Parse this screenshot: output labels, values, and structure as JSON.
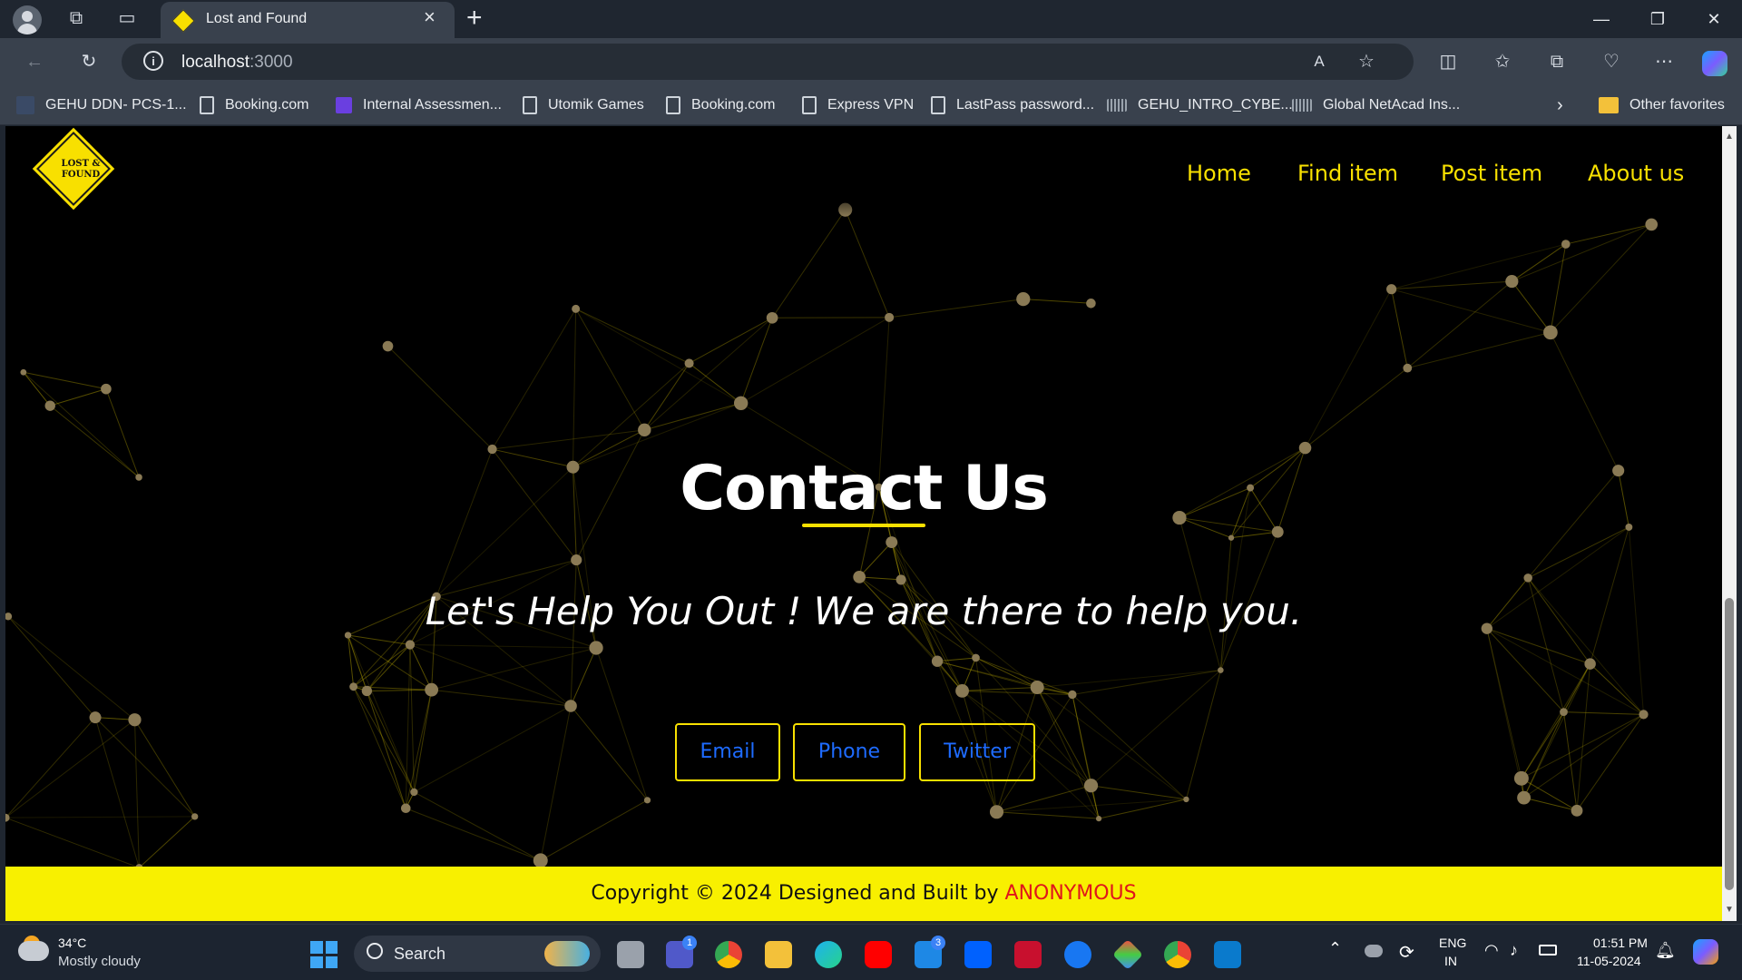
{
  "browser": {
    "tab": {
      "title": "Lost and Found"
    },
    "url": {
      "host": "localhost",
      "port": ":3000"
    },
    "favorites": [
      {
        "label": "GEHU DDN- PCS-1..."
      },
      {
        "label": "Booking.com"
      },
      {
        "label": "Internal Assessmen..."
      },
      {
        "label": "Utomik Games"
      },
      {
        "label": "Booking.com"
      },
      {
        "label": "Express VPN"
      },
      {
        "label": "LastPass password..."
      },
      {
        "label": "GEHU_INTRO_CYBE..."
      },
      {
        "label": "Global NetAcad Ins..."
      }
    ],
    "other_favorites": "Other favorites"
  },
  "site": {
    "logo_text": "LOST & FOUND",
    "nav": [
      "Home",
      "Find item",
      "Post item",
      "About us"
    ],
    "heading": "Contact Us",
    "tagline": "Let's Help You Out ! We are there to help you.",
    "buttons": [
      "Email",
      "Phone",
      "Twitter"
    ],
    "footer": {
      "text": "Copyright © 2024 Designed and Built by",
      "author": "ANONYMOUS"
    },
    "colors": {
      "accent": "#f8e000",
      "button_text": "#1e6bff",
      "author": "#e0161b"
    }
  },
  "taskbar": {
    "weather": {
      "temp": "34°C",
      "desc": "Mostly cloudy"
    },
    "search": "Search",
    "badges": {
      "teams": "1",
      "mail": "3"
    },
    "language": {
      "line1": "ENG",
      "line2": "IN"
    },
    "clock": {
      "time": "01:51 PM",
      "date": "11-05-2024"
    }
  }
}
